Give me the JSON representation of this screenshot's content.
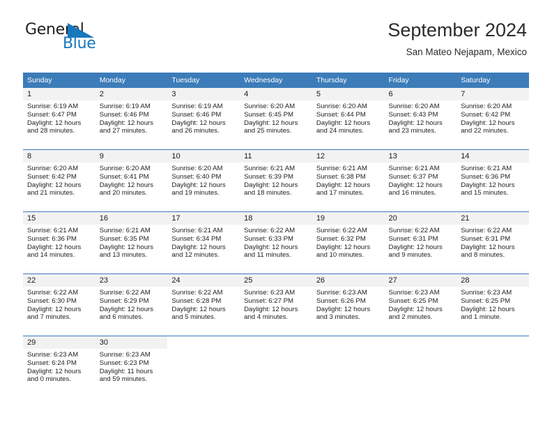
{
  "brand": {
    "name_top": "General",
    "name_bottom": "Blue",
    "triangle_icon": "blue-triangle-icon",
    "accent_color": "#1878be"
  },
  "header": {
    "title": "September 2024",
    "subtitle": "San Mateo Nejapam, Mexico"
  },
  "calendar": {
    "header_bg": "#3c7cb9",
    "daynum_bg": "#f2f2f2",
    "weekday_headers": [
      "Sunday",
      "Monday",
      "Tuesday",
      "Wednesday",
      "Thursday",
      "Friday",
      "Saturday"
    ],
    "weeks": [
      [
        {
          "day": "1",
          "sunrise": "Sunrise: 6:19 AM",
          "sunset": "Sunset: 6:47 PM",
          "daylight_line1": "Daylight: 12 hours",
          "daylight_line2": "and 28 minutes."
        },
        {
          "day": "2",
          "sunrise": "Sunrise: 6:19 AM",
          "sunset": "Sunset: 6:46 PM",
          "daylight_line1": "Daylight: 12 hours",
          "daylight_line2": "and 27 minutes."
        },
        {
          "day": "3",
          "sunrise": "Sunrise: 6:19 AM",
          "sunset": "Sunset: 6:46 PM",
          "daylight_line1": "Daylight: 12 hours",
          "daylight_line2": "and 26 minutes."
        },
        {
          "day": "4",
          "sunrise": "Sunrise: 6:20 AM",
          "sunset": "Sunset: 6:45 PM",
          "daylight_line1": "Daylight: 12 hours",
          "daylight_line2": "and 25 minutes."
        },
        {
          "day": "5",
          "sunrise": "Sunrise: 6:20 AM",
          "sunset": "Sunset: 6:44 PM",
          "daylight_line1": "Daylight: 12 hours",
          "daylight_line2": "and 24 minutes."
        },
        {
          "day": "6",
          "sunrise": "Sunrise: 6:20 AM",
          "sunset": "Sunset: 6:43 PM",
          "daylight_line1": "Daylight: 12 hours",
          "daylight_line2": "and 23 minutes."
        },
        {
          "day": "7",
          "sunrise": "Sunrise: 6:20 AM",
          "sunset": "Sunset: 6:42 PM",
          "daylight_line1": "Daylight: 12 hours",
          "daylight_line2": "and 22 minutes."
        }
      ],
      [
        {
          "day": "8",
          "sunrise": "Sunrise: 6:20 AM",
          "sunset": "Sunset: 6:42 PM",
          "daylight_line1": "Daylight: 12 hours",
          "daylight_line2": "and 21 minutes."
        },
        {
          "day": "9",
          "sunrise": "Sunrise: 6:20 AM",
          "sunset": "Sunset: 6:41 PM",
          "daylight_line1": "Daylight: 12 hours",
          "daylight_line2": "and 20 minutes."
        },
        {
          "day": "10",
          "sunrise": "Sunrise: 6:20 AM",
          "sunset": "Sunset: 6:40 PM",
          "daylight_line1": "Daylight: 12 hours",
          "daylight_line2": "and 19 minutes."
        },
        {
          "day": "11",
          "sunrise": "Sunrise: 6:21 AM",
          "sunset": "Sunset: 6:39 PM",
          "daylight_line1": "Daylight: 12 hours",
          "daylight_line2": "and 18 minutes."
        },
        {
          "day": "12",
          "sunrise": "Sunrise: 6:21 AM",
          "sunset": "Sunset: 6:38 PM",
          "daylight_line1": "Daylight: 12 hours",
          "daylight_line2": "and 17 minutes."
        },
        {
          "day": "13",
          "sunrise": "Sunrise: 6:21 AM",
          "sunset": "Sunset: 6:37 PM",
          "daylight_line1": "Daylight: 12 hours",
          "daylight_line2": "and 16 minutes."
        },
        {
          "day": "14",
          "sunrise": "Sunrise: 6:21 AM",
          "sunset": "Sunset: 6:36 PM",
          "daylight_line1": "Daylight: 12 hours",
          "daylight_line2": "and 15 minutes."
        }
      ],
      [
        {
          "day": "15",
          "sunrise": "Sunrise: 6:21 AM",
          "sunset": "Sunset: 6:36 PM",
          "daylight_line1": "Daylight: 12 hours",
          "daylight_line2": "and 14 minutes."
        },
        {
          "day": "16",
          "sunrise": "Sunrise: 6:21 AM",
          "sunset": "Sunset: 6:35 PM",
          "daylight_line1": "Daylight: 12 hours",
          "daylight_line2": "and 13 minutes."
        },
        {
          "day": "17",
          "sunrise": "Sunrise: 6:21 AM",
          "sunset": "Sunset: 6:34 PM",
          "daylight_line1": "Daylight: 12 hours",
          "daylight_line2": "and 12 minutes."
        },
        {
          "day": "18",
          "sunrise": "Sunrise: 6:22 AM",
          "sunset": "Sunset: 6:33 PM",
          "daylight_line1": "Daylight: 12 hours",
          "daylight_line2": "and 11 minutes."
        },
        {
          "day": "19",
          "sunrise": "Sunrise: 6:22 AM",
          "sunset": "Sunset: 6:32 PM",
          "daylight_line1": "Daylight: 12 hours",
          "daylight_line2": "and 10 minutes."
        },
        {
          "day": "20",
          "sunrise": "Sunrise: 6:22 AM",
          "sunset": "Sunset: 6:31 PM",
          "daylight_line1": "Daylight: 12 hours",
          "daylight_line2": "and 9 minutes."
        },
        {
          "day": "21",
          "sunrise": "Sunrise: 6:22 AM",
          "sunset": "Sunset: 6:31 PM",
          "daylight_line1": "Daylight: 12 hours",
          "daylight_line2": "and 8 minutes."
        }
      ],
      [
        {
          "day": "22",
          "sunrise": "Sunrise: 6:22 AM",
          "sunset": "Sunset: 6:30 PM",
          "daylight_line1": "Daylight: 12 hours",
          "daylight_line2": "and 7 minutes."
        },
        {
          "day": "23",
          "sunrise": "Sunrise: 6:22 AM",
          "sunset": "Sunset: 6:29 PM",
          "daylight_line1": "Daylight: 12 hours",
          "daylight_line2": "and 6 minutes."
        },
        {
          "day": "24",
          "sunrise": "Sunrise: 6:22 AM",
          "sunset": "Sunset: 6:28 PM",
          "daylight_line1": "Daylight: 12 hours",
          "daylight_line2": "and 5 minutes."
        },
        {
          "day": "25",
          "sunrise": "Sunrise: 6:23 AM",
          "sunset": "Sunset: 6:27 PM",
          "daylight_line1": "Daylight: 12 hours",
          "daylight_line2": "and 4 minutes."
        },
        {
          "day": "26",
          "sunrise": "Sunrise: 6:23 AM",
          "sunset": "Sunset: 6:26 PM",
          "daylight_line1": "Daylight: 12 hours",
          "daylight_line2": "and 3 minutes."
        },
        {
          "day": "27",
          "sunrise": "Sunrise: 6:23 AM",
          "sunset": "Sunset: 6:25 PM",
          "daylight_line1": "Daylight: 12 hours",
          "daylight_line2": "and 2 minutes."
        },
        {
          "day": "28",
          "sunrise": "Sunrise: 6:23 AM",
          "sunset": "Sunset: 6:25 PM",
          "daylight_line1": "Daylight: 12 hours",
          "daylight_line2": "and 1 minute."
        }
      ],
      [
        {
          "day": "29",
          "sunrise": "Sunrise: 6:23 AM",
          "sunset": "Sunset: 6:24 PM",
          "daylight_line1": "Daylight: 12 hours",
          "daylight_line2": "and 0 minutes."
        },
        {
          "day": "30",
          "sunrise": "Sunrise: 6:23 AM",
          "sunset": "Sunset: 6:23 PM",
          "daylight_line1": "Daylight: 11 hours",
          "daylight_line2": "and 59 minutes."
        },
        {
          "day": "",
          "sunrise": "",
          "sunset": "",
          "daylight_line1": "",
          "daylight_line2": ""
        },
        {
          "day": "",
          "sunrise": "",
          "sunset": "",
          "daylight_line1": "",
          "daylight_line2": ""
        },
        {
          "day": "",
          "sunrise": "",
          "sunset": "",
          "daylight_line1": "",
          "daylight_line2": ""
        },
        {
          "day": "",
          "sunrise": "",
          "sunset": "",
          "daylight_line1": "",
          "daylight_line2": ""
        },
        {
          "day": "",
          "sunrise": "",
          "sunset": "",
          "daylight_line1": "",
          "daylight_line2": ""
        }
      ]
    ]
  }
}
